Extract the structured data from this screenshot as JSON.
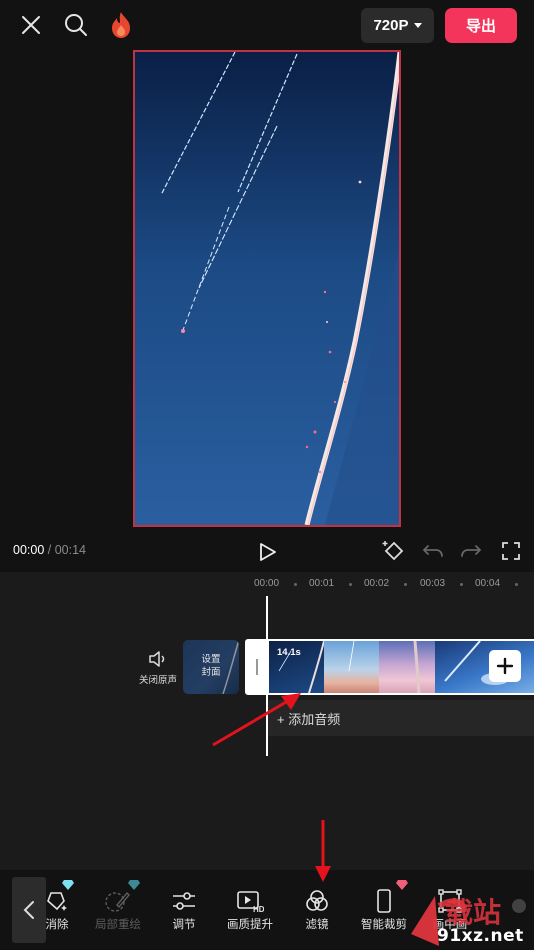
{
  "topbar": {
    "resolution_label": "720P",
    "export_label": "导出"
  },
  "player": {
    "current_time": "00:00",
    "separator": " / ",
    "total_time": "00:14"
  },
  "timeline": {
    "ruler": [
      "00:00",
      "00:01",
      "00:02",
      "00:03",
      "00:04"
    ],
    "mute_label": "关闭原声",
    "cover_label_line1": "设置",
    "cover_label_line2": "封面",
    "clip_duration": "14.1s",
    "add_audio_label": "添加音频"
  },
  "toolbar": {
    "tools": [
      {
        "label": "消除",
        "icon": "eraser-sparkle-icon",
        "premium": true
      },
      {
        "label": "局部重绘",
        "icon": "brush-icon",
        "premium": true,
        "disabled": true
      },
      {
        "label": "调节",
        "icon": "sliders-icon"
      },
      {
        "label": "画质提升",
        "icon": "hd-play-icon"
      },
      {
        "label": "滤镜",
        "icon": "filter-circles-icon"
      },
      {
        "label": "智能裁剪",
        "icon": "smart-crop-icon",
        "premium": true
      },
      {
        "label": "画中画",
        "icon": "transform-icon"
      }
    ]
  },
  "watermark": {
    "text": "91xz.net"
  },
  "colors": {
    "accent": "#f4355b",
    "frame_border": "#c03344",
    "background": "#121212"
  }
}
